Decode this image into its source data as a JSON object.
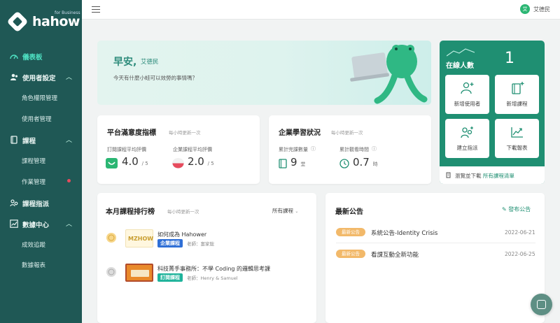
{
  "brand": {
    "name": "hahow",
    "sub": "for Business"
  },
  "sidebar": {
    "dashboard": "儀表板",
    "user_settings": "使用者設定",
    "role_permissions": "角色權限管理",
    "user_management": "使用者管理",
    "courses": "課程",
    "course_management": "課程管理",
    "assignment_management": "作業管理",
    "course_assignment": "課程指派",
    "data_center": "數據中心",
    "performance_tracking": "成效追蹤",
    "data_reports": "數據報表"
  },
  "topbar": {
    "user_initial": "艾",
    "user_name": "艾德民"
  },
  "hero": {
    "greeting": "早安,",
    "name": "艾德民",
    "subtitle": "今天有什麼小蛙可以效勞的事情嗎？"
  },
  "stats": {
    "online_label": "在線人數",
    "online_count": "1",
    "tiles": [
      {
        "label": "新增使用者",
        "icon": "add-user-icon"
      },
      {
        "label": "新增課程",
        "icon": "add-book-icon"
      },
      {
        "label": "建立指派",
        "icon": "assign-users-icon"
      },
      {
        "label": "下載報表",
        "icon": "chart-download-icon"
      }
    ],
    "download_prefix": "瀏覽並下載",
    "download_link": "所有課程清單"
  },
  "satisfaction": {
    "title": "平台滿意度指標",
    "note": "每小時更新一次",
    "subscribed_label": "訂閱課程平均評價",
    "subscribed_value": "4.0",
    "subscribed_unit": "/ 5",
    "enterprise_label": "企業課程平均評價",
    "enterprise_value": "2.0",
    "enterprise_unit": "/ 5"
  },
  "learning": {
    "title": "企業學習狀況",
    "note": "每小時更新一次",
    "completed_label": "累計完課數量",
    "completed_value": "9",
    "completed_unit": "堂",
    "watch_label": "累計觀看時間",
    "watch_value": "0.7",
    "watch_unit": "時"
  },
  "ranking": {
    "title": "本月課程排行榜",
    "note": "每小時更新一次",
    "filter": "所有課程",
    "items": [
      {
        "title": "如何成為 Hahower",
        "badge": "企業課程",
        "teacher_label": "老師",
        "teacher": "富家鋐",
        "thumb_text": "MZHOW"
      },
      {
        "title": "科技菁手事務所：不學 Coding 的邏輯思考課",
        "badge": "訂閱課程",
        "teacher_label": "老師",
        "teacher": "Henry & Samuel",
        "thumb_text": ""
      }
    ]
  },
  "announcements": {
    "title": "最新公告",
    "publish": "發布公告",
    "items": [
      {
        "badge": "最新公告",
        "title": "系統公告-Identity Crisis",
        "date": "2022-06-21"
      },
      {
        "badge": "最新公告",
        "title": "看課互動全新功能",
        "date": "2022-06-25"
      }
    ]
  },
  "colors": {
    "sidebar_bg": "#1f5855",
    "accent": "#1f8f72",
    "active": "#4ee2c3",
    "badge_blue": "#2f6fd6",
    "badge_teal": "#1fb39b",
    "badge_orange": "#f2b96a"
  }
}
